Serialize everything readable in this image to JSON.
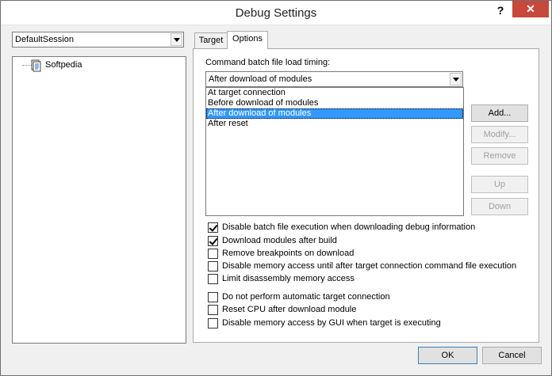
{
  "window": {
    "title": "Debug Settings",
    "help": "?",
    "close": "✕"
  },
  "session": {
    "value": "DefaultSession"
  },
  "tree": {
    "items": [
      {
        "label": "Softpedia"
      }
    ]
  },
  "tabs": [
    {
      "label": "Target"
    },
    {
      "label": "Options"
    }
  ],
  "options": {
    "timing_label": "Command batch file load timing:",
    "timing_value": "After download of modules",
    "timing_options": [
      "At target connection",
      "Before download of modules",
      "After download of modules",
      "After reset"
    ],
    "selected_index": 2,
    "buttons": {
      "add": "Add...",
      "modify": "Modify...",
      "remove": "Remove",
      "up": "Up",
      "down": "Down"
    },
    "checkboxes": [
      {
        "label": "Disable batch file execution when downloading debug information",
        "checked": true
      },
      {
        "label": "Download modules after build",
        "checked": true
      },
      {
        "label": "Remove breakpoints on download",
        "checked": false
      },
      {
        "label": "Disable memory access until after target connection command file execution",
        "checked": false
      },
      {
        "label": "Limit disassembly memory access",
        "checked": false
      },
      {
        "label": "Do not perform automatic target connection",
        "checked": false
      },
      {
        "label": "Reset CPU after download module",
        "checked": false
      },
      {
        "label": "Disable memory access by GUI when target is executing",
        "checked": false
      }
    ]
  },
  "footer": {
    "ok": "OK",
    "cancel": "Cancel"
  }
}
